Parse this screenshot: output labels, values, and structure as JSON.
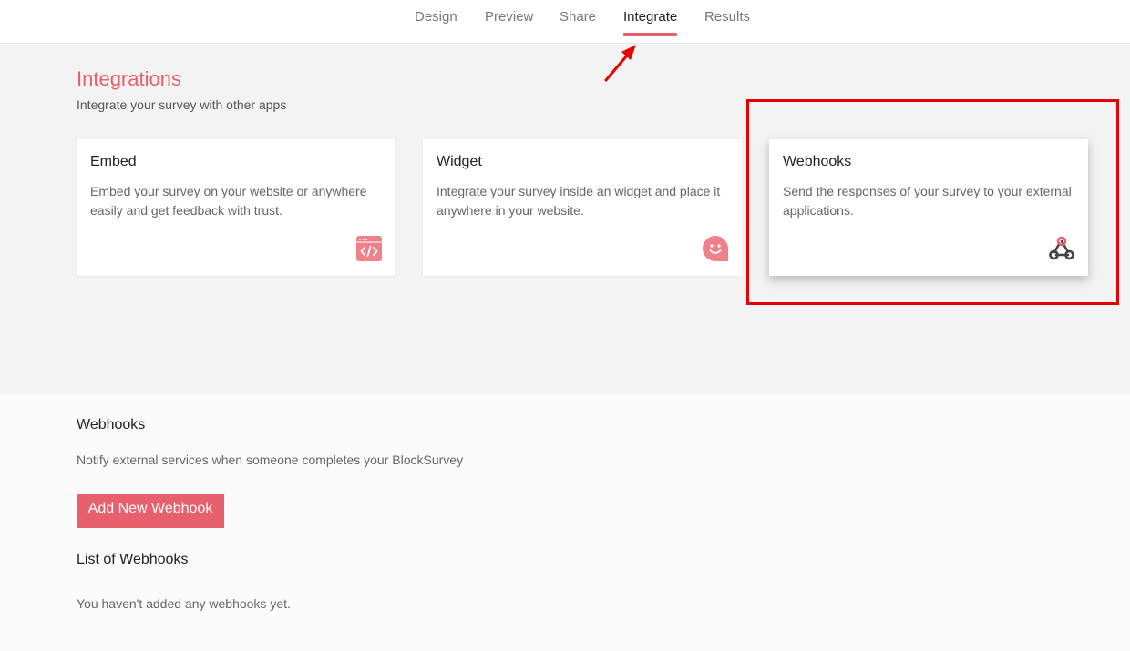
{
  "nav": {
    "tabs": [
      {
        "label": "Design"
      },
      {
        "label": "Preview"
      },
      {
        "label": "Share"
      },
      {
        "label": "Integrate",
        "active": true
      },
      {
        "label": "Results"
      }
    ]
  },
  "integrations": {
    "title": "Integrations",
    "subtitle": "Integrate your survey with other apps",
    "cards": [
      {
        "title": "Embed",
        "description": "Embed your survey on your website or anywhere easily and get feedback with trust.",
        "icon": "code-window-icon"
      },
      {
        "title": "Widget",
        "description": "Integrate your survey inside an widget and place it anywhere in your website.",
        "icon": "smiley-chat-icon"
      },
      {
        "title": "Webhooks",
        "description": "Send the responses of your survey to your external applications.",
        "icon": "webhook-icon"
      }
    ]
  },
  "webhooks": {
    "title": "Webhooks",
    "description": "Notify external services when someone completes your BlockSurvey",
    "add_button": "Add New Webhook",
    "list_title": "List of Webhooks",
    "empty_message": "You haven't added any webhooks yet."
  },
  "colors": {
    "accent": "#e8606e",
    "annotation_red": "#e60000",
    "top_background": "#f3f3f3",
    "bottom_background": "#fbfbfb"
  }
}
